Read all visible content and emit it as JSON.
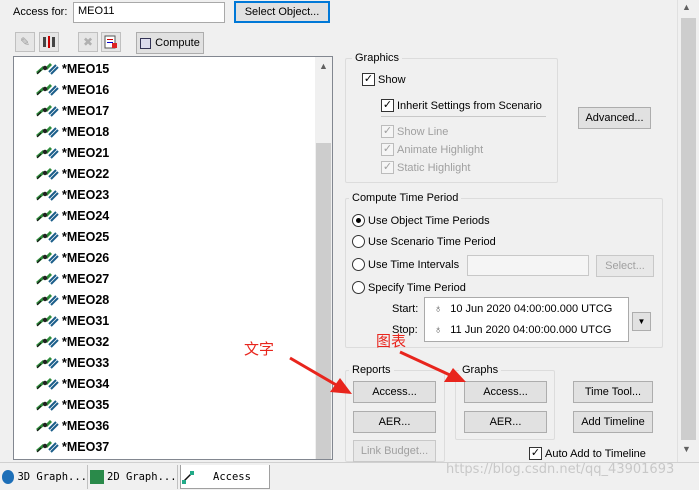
{
  "header": {
    "access_for_label": "Access for:",
    "object_name": "MEO11",
    "select_object_label": "Select Object..."
  },
  "toolbar": {
    "compute_label": "Compute"
  },
  "object_list": {
    "items": [
      "*MEO15",
      "*MEO16",
      "*MEO17",
      "*MEO18",
      "*MEO21",
      "*MEO22",
      "*MEO23",
      "*MEO24",
      "*MEO25",
      "*MEO26",
      "*MEO27",
      "*MEO28",
      "*MEO31",
      "*MEO32",
      "*MEO33",
      "*MEO34",
      "*MEO35",
      "*MEO36",
      "*MEO37"
    ]
  },
  "graphics": {
    "title": "Graphics",
    "show": "Show",
    "inherit": "Inherit Settings from Scenario",
    "show_line": "Show Line",
    "animate_highlight": "Animate Highlight",
    "static_highlight": "Static Highlight",
    "advanced_label": "Advanced..."
  },
  "compute_time": {
    "title": "Compute Time Period",
    "use_object": "Use Object Time Periods",
    "use_scenario": "Use Scenario Time Period",
    "use_intervals": "Use Time Intervals",
    "select_label": "Select...",
    "specify": "Specify Time Period",
    "start_label": "Start:",
    "start_value": "10 Jun 2020 04:00:00.000 UTCG",
    "stop_label": "Stop:",
    "stop_value": "11 Jun 2020 04:00:00.000 UTCG"
  },
  "reports": {
    "title": "Reports",
    "access_label": "Access...",
    "aer_label": "AER...",
    "link_budget_label": "Link Budget..."
  },
  "graphs": {
    "title": "Graphs",
    "access_label": "Access...",
    "aer_label": "AER..."
  },
  "timeline": {
    "time_tool_label": "Time Tool...",
    "add_timeline_label": "Add Timeline",
    "auto_add_label": "Auto Add to Timeline"
  },
  "annotations": {
    "text_label": "文字",
    "graph_label": "图表",
    "color": "#e8251d"
  },
  "tabs": [
    {
      "label": "3D Graph..."
    },
    {
      "label": "2D Graph..."
    },
    {
      "label": "Access"
    }
  ],
  "watermark": "https://blog.csdn.net/qq_43901693"
}
